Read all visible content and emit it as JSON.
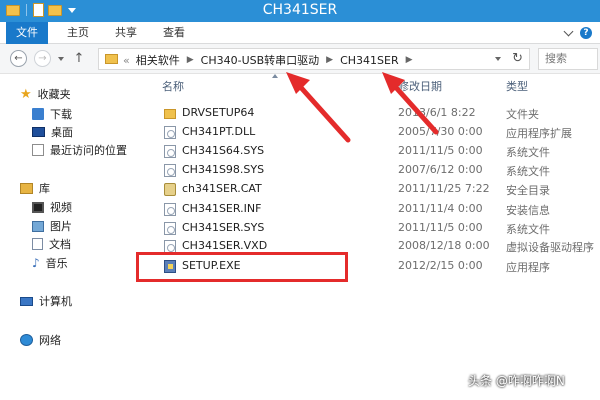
{
  "window": {
    "title": "CH341SER"
  },
  "ribbon": {
    "tabs": [
      "文件",
      "主页",
      "共享",
      "查看"
    ]
  },
  "address": {
    "lead": "«",
    "crumbs": [
      "相关软件",
      "CH340-USB转串口驱动",
      "CH341SER"
    ],
    "search_placeholder": "搜索"
  },
  "nav": {
    "favorites": "收藏夹",
    "downloads": "下载",
    "desktop": "桌面",
    "recent": "最近访问的位置",
    "libraries": "库",
    "videos": "视频",
    "pictures": "图片",
    "documents": "文档",
    "music": "音乐",
    "computer": "计算机",
    "network": "网络"
  },
  "columns": {
    "name": "名称",
    "date": "修改日期",
    "type": "类型"
  },
  "files": [
    {
      "name": "DRVSETUP64",
      "date": "2013/6/1 8:22",
      "type": "文件夹",
      "icon": "folder-icon"
    },
    {
      "name": "CH341PT.DLL",
      "date": "2005/7/30 0:00",
      "type": "应用程序扩展",
      "icon": "dll-file-icon"
    },
    {
      "name": "CH341S64.SYS",
      "date": "2011/11/5 0:00",
      "type": "系统文件",
      "icon": "sys-file-icon"
    },
    {
      "name": "CH341S98.SYS",
      "date": "2007/6/12 0:00",
      "type": "系统文件",
      "icon": "sys-file-icon"
    },
    {
      "name": "ch341SER.CAT",
      "date": "2011/11/25 7:22",
      "type": "安全目录",
      "icon": "catalog-file-icon"
    },
    {
      "name": "CH341SER.INF",
      "date": "2011/11/4 0:00",
      "type": "安装信息",
      "icon": "inf-file-icon"
    },
    {
      "name": "CH341SER.SYS",
      "date": "2011/11/5 0:00",
      "type": "系统文件",
      "icon": "sys-file-icon"
    },
    {
      "name": "CH341SER.VXD",
      "date": "2008/12/18 0:00",
      "type": "虚拟设备驱动程序",
      "icon": "vxd-file-icon"
    },
    {
      "name": "SETUP.EXE",
      "date": "2012/2/15 0:00",
      "type": "应用程序",
      "icon": "exe-file-icon"
    }
  ],
  "watermark": "头条 @咋啊咋啊N",
  "colors": {
    "titlebar": "#2b8fd6",
    "annotation_red": "#e42b2b"
  }
}
